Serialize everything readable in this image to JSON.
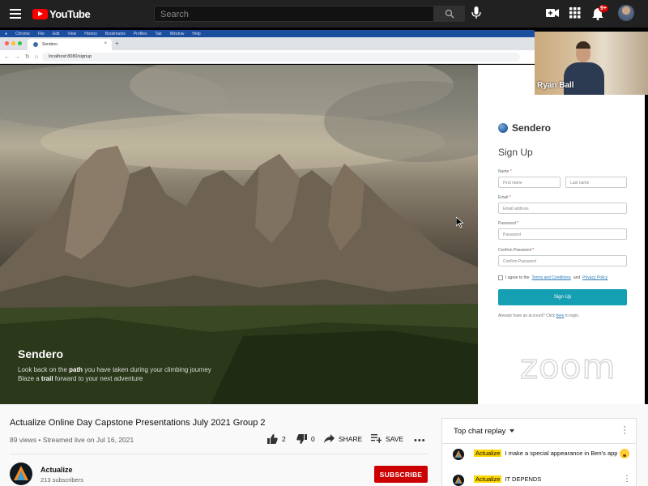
{
  "header": {
    "logo_text": "YouTube",
    "search_placeholder": "Search",
    "notification_count": "9+"
  },
  "shared_screen": {
    "mac_menu": [
      "Chrome",
      "File",
      "Edit",
      "View",
      "History",
      "Bookmarks",
      "Profiles",
      "Tab",
      "Window",
      "Help"
    ],
    "tab_title": "Sendero",
    "url": "localhost:8080/signup",
    "hero": {
      "title": "Sendero",
      "line1_pre": "Look back on the ",
      "line1_bold": "path",
      "line1_post": " you have taken during your climbing journey",
      "line2_pre": "Blaze a ",
      "line2_bold": "trail",
      "line2_post": " forward to your next adventure"
    },
    "form": {
      "brand": "Sendero",
      "title": "Sign Up",
      "name_label": "Name",
      "first_name_placeholder": "First name",
      "last_name_placeholder": "Last name",
      "email_label": "Email",
      "email_placeholder": "Email address",
      "password_label": "Password",
      "password_placeholder": "Password",
      "confirm_label": "Confirm Password",
      "confirm_placeholder": "Confirm Password",
      "required_mark": "*",
      "terms_pre": "I agree to the",
      "terms_link": "Terms and Conditions",
      "terms_and": "and",
      "privacy_link": "Privacy Policy",
      "submit": "Sign Up",
      "login_pre": "Already have an account? Click",
      "login_link": "here",
      "login_post": "to login."
    },
    "watermark": "zoom",
    "webcam_name": "Ryan Ball"
  },
  "video": {
    "title": "Actualize Online Day Capstone Presentations July 2021 Group 2",
    "stats": "89 views • Streamed live on Jul 16, 2021",
    "likes": "2",
    "dislikes": "0",
    "share_label": "SHARE",
    "save_label": "SAVE",
    "more_label": "•••"
  },
  "channel": {
    "name": "Actualize",
    "subscribers": "213 subscribers",
    "subscribe_label": "SUBSCRIBE"
  },
  "chat": {
    "header": "Top chat replay",
    "messages": [
      {
        "author": "Actualize",
        "text": "I make a special appearance in Ben's app"
      },
      {
        "author": "Actualize",
        "text": "IT DEPENDS"
      }
    ]
  },
  "colors": {
    "youtube_red": "#ff0000",
    "subscribe_red": "#cc0000",
    "signup_teal": "#159fb3",
    "author_tag_yellow": "#ffd600"
  }
}
